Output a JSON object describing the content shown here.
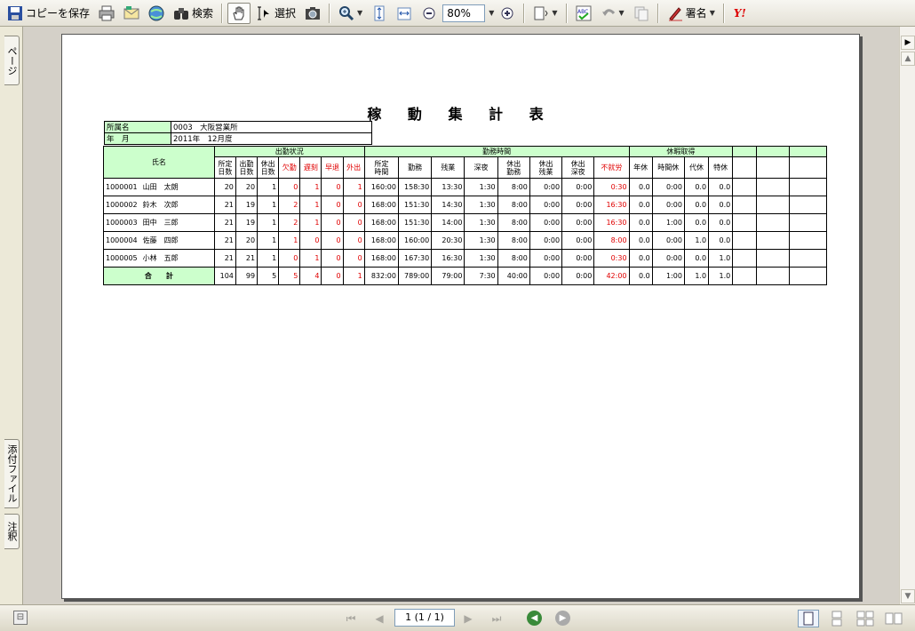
{
  "toolbar": {
    "save_copy": "コピーを保存",
    "search": "検索",
    "select": "選択",
    "zoom_value": "80%",
    "sign": "署名",
    "yahoo": "Y!"
  },
  "side_tabs": {
    "pages": "ページ",
    "attachments": "添付ファイル",
    "comments": "注釈"
  },
  "report": {
    "title": "稼 動 集 計 表",
    "info": [
      {
        "label": "所属名",
        "value": "0003　大阪営業所"
      },
      {
        "label": "年　月",
        "value": "2011年　12月度"
      }
    ],
    "groups": {
      "name": "氏名",
      "attendance": "出勤状況",
      "work_hours": "勤務時間",
      "leave": "休暇取得"
    },
    "columns": {
      "attendance": [
        "所定\n日数",
        "出勤\n日数",
        "休出\n日数",
        "欠勤",
        "遅刻",
        "早退",
        "外出"
      ],
      "work": [
        "所定\n時間",
        "勤務",
        "残業",
        "深夜",
        "休出\n勤務",
        "休出\n残業",
        "休出\n深夜",
        "不就労"
      ],
      "leave": [
        "年休",
        "時間休",
        "代休",
        "特休"
      ]
    },
    "rows": [
      {
        "id": "1000001",
        "name": "山田　太朗",
        "att": [
          "20",
          "20",
          "1",
          "0",
          "1",
          "0",
          "1"
        ],
        "work": [
          "160:00",
          "158:30",
          "13:30",
          "1:30",
          "8:00",
          "0:00",
          "0:00",
          "0:30"
        ],
        "leave": [
          "0.0",
          "0:00",
          "0.0",
          "0.0"
        ]
      },
      {
        "id": "1000002",
        "name": "鈴木　次郎",
        "att": [
          "21",
          "19",
          "1",
          "2",
          "1",
          "0",
          "0"
        ],
        "work": [
          "168:00",
          "151:30",
          "14:30",
          "1:30",
          "8:00",
          "0:00",
          "0:00",
          "16:30"
        ],
        "leave": [
          "0.0",
          "0:00",
          "0.0",
          "0.0"
        ]
      },
      {
        "id": "1000003",
        "name": "田中　三郎",
        "att": [
          "21",
          "19",
          "1",
          "2",
          "1",
          "0",
          "0"
        ],
        "work": [
          "168:00",
          "151:30",
          "14:00",
          "1:30",
          "8:00",
          "0:00",
          "0:00",
          "16:30"
        ],
        "leave": [
          "0.0",
          "1:00",
          "0.0",
          "0.0"
        ]
      },
      {
        "id": "1000004",
        "name": "佐藤　四郎",
        "att": [
          "21",
          "20",
          "1",
          "1",
          "0",
          "0",
          "0"
        ],
        "work": [
          "168:00",
          "160:00",
          "20:30",
          "1:30",
          "8:00",
          "0:00",
          "0:00",
          "8:00"
        ],
        "leave": [
          "0.0",
          "0:00",
          "1.0",
          "0.0"
        ]
      },
      {
        "id": "1000005",
        "name": "小林　五郎",
        "att": [
          "21",
          "21",
          "1",
          "0",
          "1",
          "0",
          "0"
        ],
        "work": [
          "168:00",
          "167:30",
          "16:30",
          "1:30",
          "8:00",
          "0:00",
          "0:00",
          "0:30"
        ],
        "leave": [
          "0.0",
          "0:00",
          "0.0",
          "1.0"
        ]
      }
    ],
    "total": {
      "label": "合　　計",
      "att": [
        "104",
        "99",
        "5",
        "5",
        "4",
        "0",
        "1"
      ],
      "work": [
        "832:00",
        "789:00",
        "79:00",
        "7:30",
        "40:00",
        "0:00",
        "0:00",
        "42:00"
      ],
      "leave": [
        "0.0",
        "1:00",
        "1.0",
        "1.0"
      ]
    }
  },
  "statusbar": {
    "page_indicator": "1 (1 / 1)"
  },
  "colors": {
    "header_green": "#ccffcc",
    "red_text": "#e00000"
  }
}
